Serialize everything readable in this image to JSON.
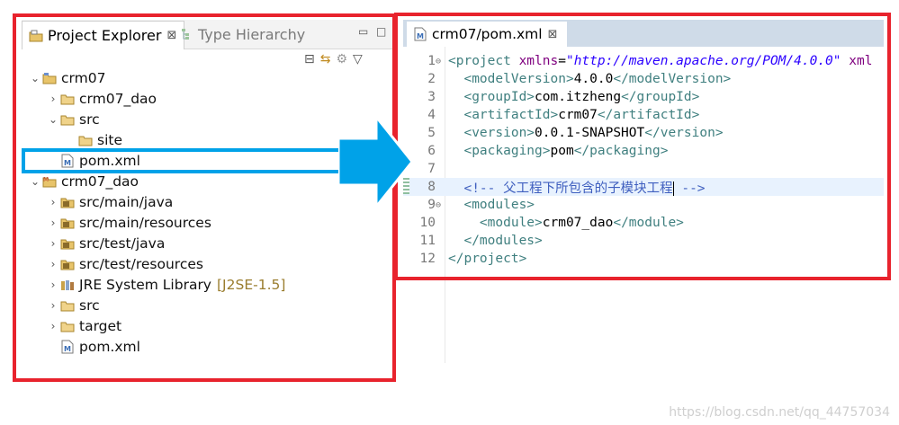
{
  "explorer": {
    "tab_active": "Project Explorer",
    "tab_active_close": "⊠",
    "tab_inactive": "Type Hierarchy",
    "tree": [
      {
        "label": "crm07",
        "arrow": "⌄",
        "indent": 0,
        "icon": "project-folder-icon"
      },
      {
        "label": "crm07_dao",
        "arrow": "›",
        "indent": 1,
        "icon": "folder-icon"
      },
      {
        "label": "src",
        "arrow": "⌄",
        "indent": 1,
        "icon": "folder-icon"
      },
      {
        "label": "site",
        "arrow": "",
        "indent": 2,
        "icon": "folder-icon"
      },
      {
        "label": "pom.xml",
        "arrow": "",
        "indent": 1,
        "icon": "xml-file-icon"
      },
      {
        "label": "crm07_dao",
        "arrow": "⌄",
        "indent": 0,
        "icon": "maven-project-icon"
      },
      {
        "label": "src/main/java",
        "arrow": "›",
        "indent": 1,
        "icon": "source-folder-icon"
      },
      {
        "label": "src/main/resources",
        "arrow": "›",
        "indent": 1,
        "icon": "source-folder-icon"
      },
      {
        "label": "src/test/java",
        "arrow": "›",
        "indent": 1,
        "icon": "source-folder-icon"
      },
      {
        "label": "src/test/resources",
        "arrow": "›",
        "indent": 1,
        "icon": "source-folder-icon"
      },
      {
        "label": "JRE System Library",
        "decor": "[J2SE-1.5]",
        "arrow": "›",
        "indent": 1,
        "icon": "library-icon"
      },
      {
        "label": "src",
        "arrow": "›",
        "indent": 1,
        "icon": "folder-icon"
      },
      {
        "label": "target",
        "arrow": "›",
        "indent": 1,
        "icon": "folder-icon"
      },
      {
        "label": "pom.xml",
        "arrow": "",
        "indent": 1,
        "icon": "xml-file-icon"
      }
    ]
  },
  "editor": {
    "tab_title": "crm07/pom.xml",
    "tab_close": "⊠",
    "lines": [
      {
        "n": "1",
        "fold": "⊖",
        "segments": [
          [
            "tag",
            "<project "
          ],
          [
            "attr",
            "xmlns"
          ],
          [
            "txt",
            "="
          ],
          [
            "str",
            "\"http://maven.apache.org/POM/4.0.0\""
          ],
          [
            "attr",
            " xml"
          ]
        ]
      },
      {
        "n": "2",
        "segments": [
          [
            "tag",
            "  <modelVersion>"
          ],
          [
            "txt",
            "4.0.0"
          ],
          [
            "tag",
            "</modelVersion>"
          ]
        ]
      },
      {
        "n": "3",
        "segments": [
          [
            "tag",
            "  <groupId>"
          ],
          [
            "txt",
            "com.itzheng"
          ],
          [
            "tag",
            "</groupId>"
          ]
        ]
      },
      {
        "n": "4",
        "segments": [
          [
            "tag",
            "  <artifactId>"
          ],
          [
            "txt",
            "crm07"
          ],
          [
            "tag",
            "</artifactId>"
          ]
        ]
      },
      {
        "n": "5",
        "segments": [
          [
            "tag",
            "  <version>"
          ],
          [
            "txt",
            "0.0.1-SNAPSHOT"
          ],
          [
            "tag",
            "</version>"
          ]
        ]
      },
      {
        "n": "6",
        "segments": [
          [
            "tag",
            "  <packaging>"
          ],
          [
            "txt",
            "pom"
          ],
          [
            "tag",
            "</packaging>"
          ]
        ]
      },
      {
        "n": "7",
        "segments": []
      },
      {
        "n": "8",
        "highlight": true,
        "segments": [
          [
            "cmt",
            "  <!-- 父工程下所包含的子模块工程"
          ],
          [
            "caret",
            ""
          ],
          [
            "cmt",
            " -->"
          ]
        ]
      },
      {
        "n": "9",
        "fold": "⊖",
        "segments": [
          [
            "tag",
            "  <modules>"
          ]
        ]
      },
      {
        "n": "10",
        "segments": [
          [
            "tag",
            "    <module>"
          ],
          [
            "txt",
            "crm07_dao"
          ],
          [
            "tag",
            "</module>"
          ]
        ]
      },
      {
        "n": "11",
        "segments": [
          [
            "tag",
            "  </modules>"
          ]
        ]
      },
      {
        "n": "12",
        "segments": [
          [
            "tag",
            "</project>"
          ]
        ]
      }
    ]
  },
  "watermark": "https://blog.csdn.net/qq_44757034",
  "colors": {
    "red_box": "#e8232d",
    "blue_arrow": "#00a2e8"
  }
}
